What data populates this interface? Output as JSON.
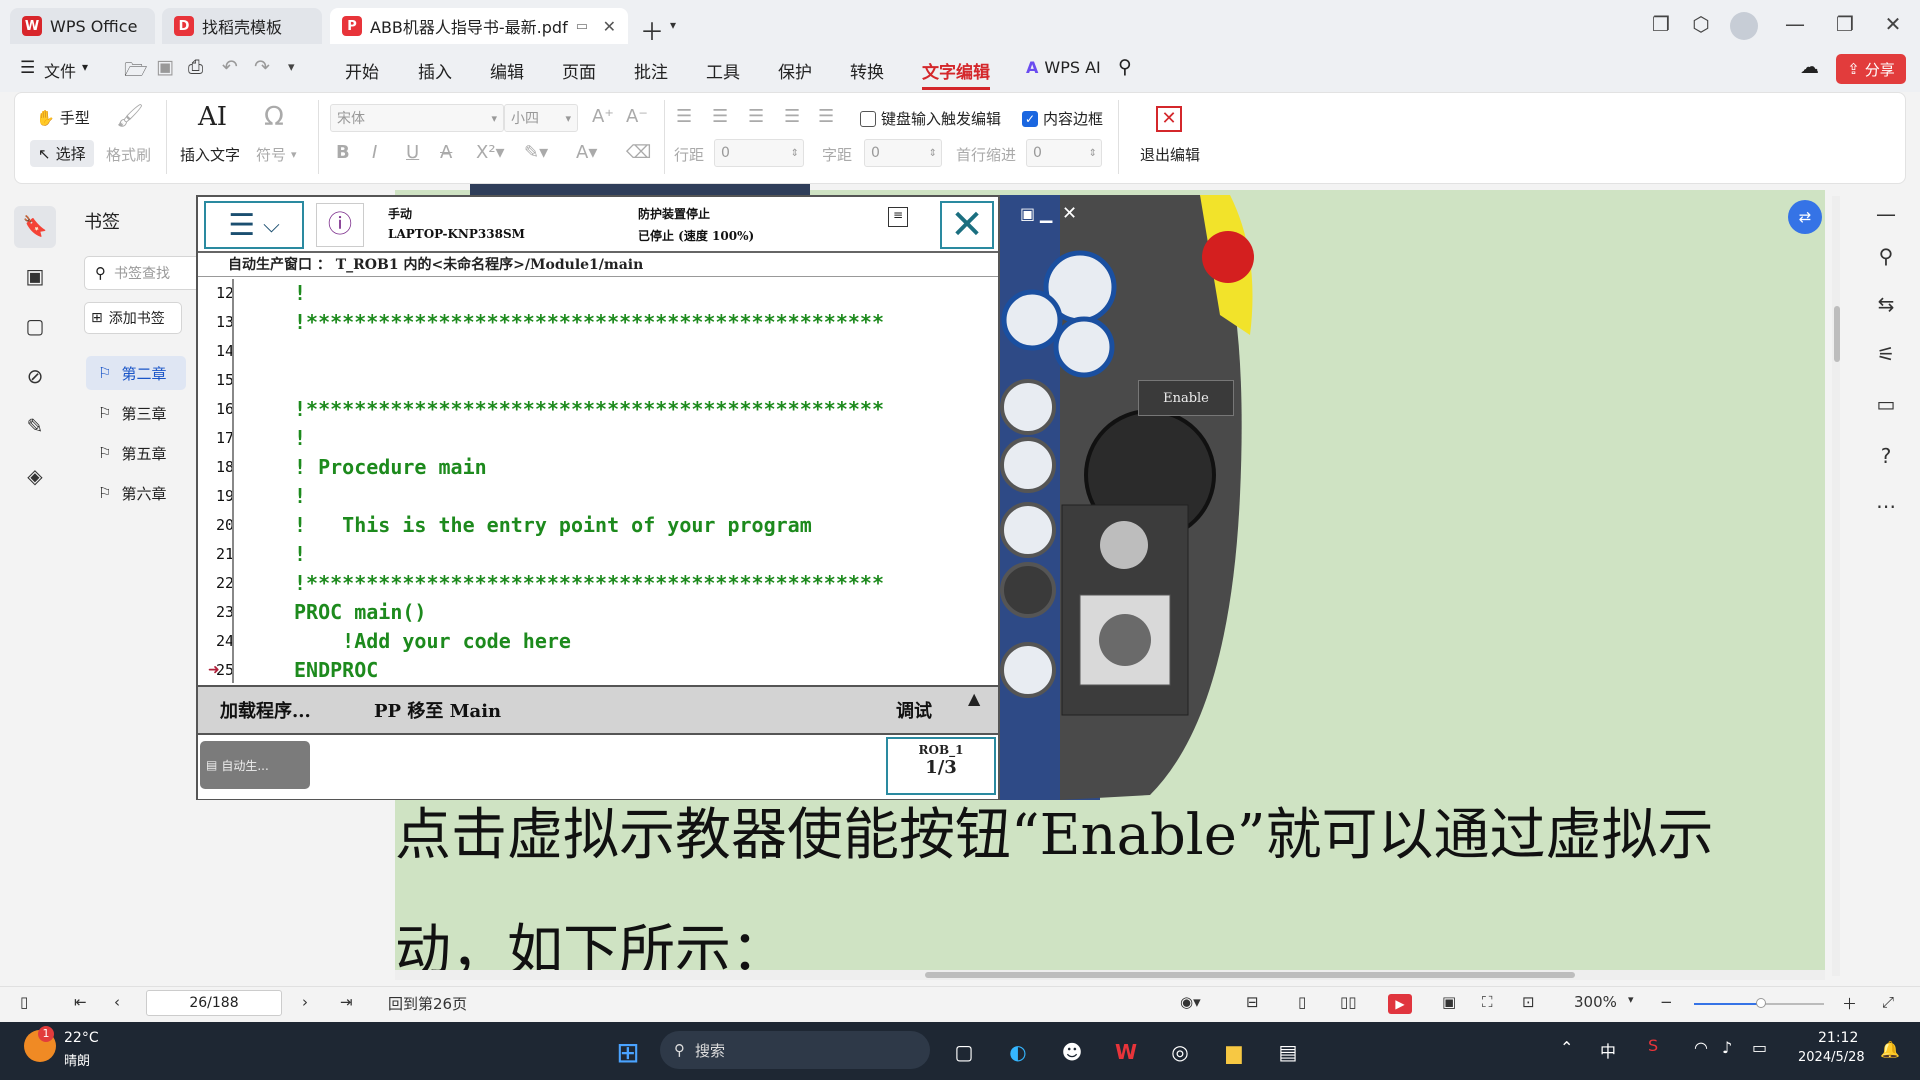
{
  "tabs": [
    {
      "label": "WPS Office",
      "icon": "wps-logo-icon"
    },
    {
      "label": "找稻壳模板",
      "icon": "docer-icon"
    },
    {
      "label": "ABB机器人指导书-最新.pdf",
      "icon": "pdf-icon"
    }
  ],
  "menu": {
    "file": "文件",
    "items": [
      "开始",
      "插入",
      "编辑",
      "页面",
      "批注",
      "工具",
      "保护",
      "转换",
      "文字编辑"
    ],
    "active": "文字编辑",
    "wps_ai": "WPS AI",
    "share": "分享"
  },
  "ribbon": {
    "hand": "手型",
    "select": "选择",
    "format_brush": "格式刷",
    "insert_text": "插入文字",
    "symbol": "符号",
    "font_family": "宋体",
    "font_size": "小四",
    "keyboard_trigger": "键盘输入触发编辑",
    "content_border": "内容边框",
    "line_spacing_label": "行距",
    "line_spacing_value": "0",
    "char_spacing_label": "字距",
    "char_spacing_value": "0",
    "first_indent_label": "首行缩进",
    "first_indent_value": "0",
    "exit_edit": "退出编辑"
  },
  "bookmarks": {
    "title": "书签",
    "search_placeholder": "书签查找",
    "add": "添加书签",
    "items": [
      "第二章",
      "第三章",
      "第五章",
      "第六章"
    ],
    "selected": "第二章"
  },
  "pendant": {
    "mode": "手动",
    "host": "LAPTOP-KNP338SM",
    "guard": "防护装置停止",
    "state": "已停止 (速度 100%)",
    "path": "自动生产窗口 ： T_ROB1 内的<未命名程序>/Module1/main",
    "code": [
      {
        "n": "12",
        "t": "!"
      },
      {
        "n": "13",
        "t": "!************************************************"
      },
      {
        "n": "14",
        "t": ""
      },
      {
        "n": "15",
        "t": ""
      },
      {
        "n": "16",
        "t": "!************************************************"
      },
      {
        "n": "17",
        "t": "!"
      },
      {
        "n": "18",
        "t": "! Procedure main"
      },
      {
        "n": "19",
        "t": "!"
      },
      {
        "n": "20",
        "t": "!   This is the entry point of your program"
      },
      {
        "n": "21",
        "t": "!"
      },
      {
        "n": "22",
        "t": "!************************************************"
      },
      {
        "n": "23",
        "t": "PROC main()"
      },
      {
        "n": "24",
        "t": "    !Add your code here"
      },
      {
        "n": "25",
        "t": "ENDPROC"
      }
    ],
    "load_program": "加载程序...",
    "pp_to_main": "PP 移至 Main",
    "debug": "调试",
    "task_button": "自动生...",
    "rob": "ROB_1",
    "fraction": "1/3",
    "enable_label": "Enable"
  },
  "doc": {
    "line1": "点击虚拟示教器使能按钮“Enable”就可以通过虚拟示",
    "line2": "动，如下所示："
  },
  "statusbar": {
    "page_input": "26/188",
    "back_to": "回到第26页",
    "zoom": "300%"
  },
  "taskbar": {
    "temp": "22°C",
    "weather": "晴朗",
    "badge": "1",
    "search": "搜索",
    "ime": "中",
    "time": "21:12",
    "date": "2024/5/28"
  }
}
